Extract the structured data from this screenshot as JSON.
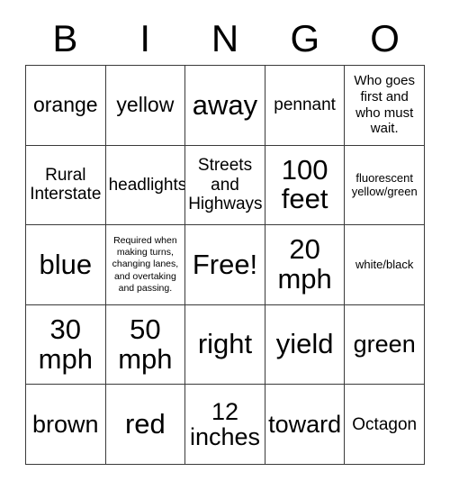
{
  "card": {
    "title": "BINGO",
    "header_letters": [
      "B",
      "I",
      "N",
      "G",
      "O"
    ],
    "free_space": "Free!",
    "grid": {
      "rows": 5,
      "columns": 5,
      "cells": [
        [
          {
            "text": "orange",
            "size": "lg"
          },
          {
            "text": "yellow",
            "size": "lg"
          },
          {
            "text": "away",
            "size": "xxl"
          },
          {
            "text": "pennant",
            "size": "md"
          },
          {
            "text": "Who goes first and who must wait.",
            "size": "sm"
          }
        ],
        [
          {
            "text": "Rural Interstate",
            "size": "md"
          },
          {
            "text": "headlights",
            "size": "md"
          },
          {
            "text": "Streets and Highways",
            "size": "md"
          },
          {
            "text": "100 feet",
            "size": "xxl"
          },
          {
            "text": "fluorescent yellow/green",
            "size": "xs"
          }
        ],
        [
          {
            "text": "blue",
            "size": "xxl"
          },
          {
            "text": "Required when making turns, changing lanes, and overtaking and passing.",
            "size": "xxs"
          },
          {
            "text": "Free!",
            "size": "xxl"
          },
          {
            "text": "20 mph",
            "size": "xxl"
          },
          {
            "text": "white/black",
            "size": "xs"
          }
        ],
        [
          {
            "text": "30 mph",
            "size": "xxl"
          },
          {
            "text": "50 mph",
            "size": "xxl"
          },
          {
            "text": "right",
            "size": "xxl"
          },
          {
            "text": "yield",
            "size": "xxl"
          },
          {
            "text": "green",
            "size": "xl"
          }
        ],
        [
          {
            "text": "brown",
            "size": "xl"
          },
          {
            "text": "red",
            "size": "xxl"
          },
          {
            "text": "12 inches",
            "size": "xl"
          },
          {
            "text": "toward",
            "size": "xl"
          },
          {
            "text": "Octagon",
            "size": "md"
          }
        ]
      ]
    },
    "colors": {
      "background": "#ffffff",
      "text": "#000000",
      "border": "#3a3a3a"
    }
  }
}
